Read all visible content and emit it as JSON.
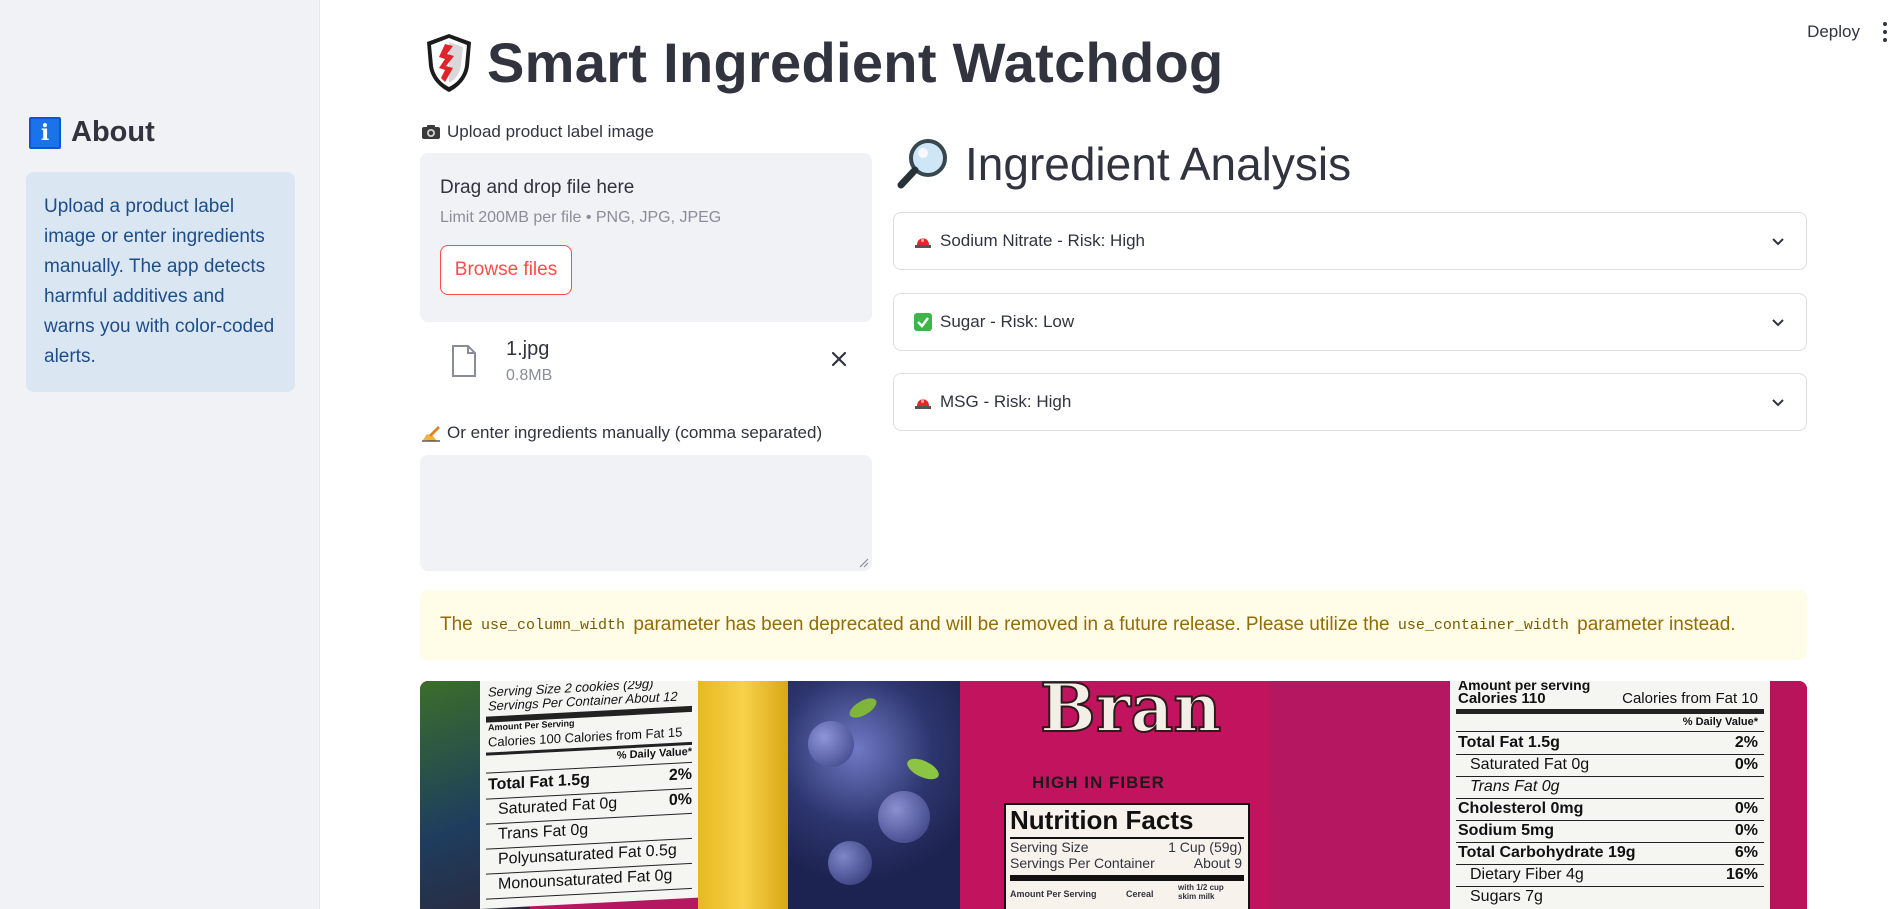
{
  "sidebar": {
    "header": "About",
    "info_text": "Upload a product label image or enter ingredients manually. The app detects harmful additives and warns you with color-coded alerts."
  },
  "toolbar": {
    "deploy_label": "Deploy"
  },
  "main": {
    "title": "Smart Ingredient Watchdog",
    "upload": {
      "label": "Upload product label image",
      "drag_text": "Drag and drop file here",
      "limit_text": "Limit 200MB per file • PNG, JPG, JPEG",
      "browse_label": "Browse files",
      "file": {
        "name": "1.jpg",
        "size": "0.8MB"
      }
    },
    "manual": {
      "label": "Or enter ingredients manually (comma separated)",
      "value": ""
    },
    "analysis": {
      "title": "Ingredient Analysis",
      "items": [
        {
          "label": "Sodium Nitrate - Risk: High",
          "icon": "siren-icon"
        },
        {
          "label": "Sugar - Risk: Low",
          "icon": "check-icon"
        },
        {
          "label": "MSG - Risk: High",
          "icon": "siren-icon"
        }
      ]
    },
    "warning": {
      "text_1": "The ",
      "code_1": "use_column_width",
      "text_2": " parameter has been deprecated and will be removed in a future release. Please utilize the ",
      "code_2": "use_container_width",
      "text_3": " parameter instead."
    },
    "image_text": {
      "left_serving_1": "Serving Size 2 cookies (29g)",
      "left_serving_2": "Servings Per Container About 12",
      "left_amount": "Amount Per Serving",
      "left_calories": "Calories 100   Calories from Fat 15",
      "left_dv": "% Daily Value*",
      "left_total_fat": "Total Fat 1.5g",
      "left_total_fat_pct": "2%",
      "left_sat_fat": "Saturated Fat 0g",
      "left_sat_fat_pct": "0%",
      "left_trans_fat": "Trans Fat 0g",
      "left_poly_fat": "Polyunsaturated Fat 0.5g",
      "left_mono_fat": "Monounsaturated Fat 0g",
      "box_brand": "Bran",
      "box_fiber": "HIGH IN FIBER",
      "box_nf": "Nutrition Facts",
      "box_serving": "Serving Size",
      "box_serving_val": "1 Cup (59g)",
      "box_servings": "Servings Per Container",
      "box_servings_val": "About 9",
      "box_amount": "Amount Per Serving",
      "box_cereal": "Cereal",
      "box_with_milk": "with 1/2 cup skim milk",
      "right_amount": "Amount per serving",
      "right_calories": "Calories 110",
      "right_cal_fat": "Calories from Fat 10",
      "right_dv": "% Daily Value*",
      "right_total_fat": "Total Fat 1.5g",
      "right_total_fat_pct": "2%",
      "right_sat_fat": "Saturated Fat 0g",
      "right_sat_fat_pct": "0%",
      "right_trans_fat": "Trans Fat 0g",
      "right_chol": "Cholesterol 0mg",
      "right_chol_pct": "0%",
      "right_sodium": "Sodium 5mg",
      "right_sodium_pct": "0%",
      "right_carb": "Total Carbohydrate 19g",
      "right_carb_pct": "6%",
      "right_fiber": "Dietary Fiber 4g",
      "right_fiber_pct": "16%",
      "right_sugars": "Sugars 7g"
    }
  },
  "colors": {
    "accent": "#ff4b4b",
    "sidebar_bg": "#f0f2f6",
    "info_bg": "#dbe6f3",
    "warning_bg": "#fffce7",
    "warning_text": "#926c05"
  }
}
